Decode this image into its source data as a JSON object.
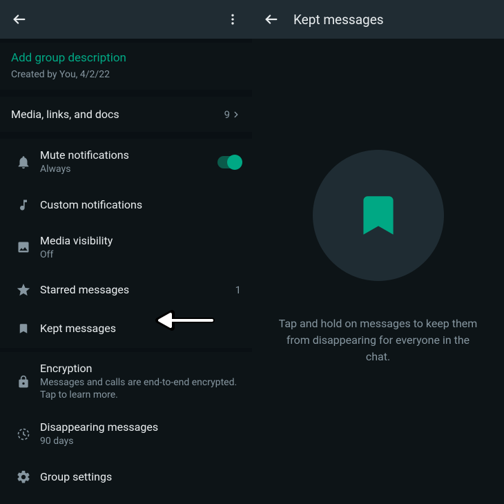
{
  "left": {
    "addDesc": "Add group description",
    "created": "Created by You, 4/2/22",
    "media": {
      "label": "Media, links, and docs",
      "count": "9"
    },
    "rows": {
      "mute": {
        "title": "Mute notifications",
        "sub": "Always"
      },
      "custom": {
        "title": "Custom notifications"
      },
      "mediaV": {
        "title": "Media visibility",
        "sub": "Off"
      },
      "starred": {
        "title": "Starred messages",
        "count": "1"
      },
      "kept": {
        "title": "Kept messages"
      },
      "enc": {
        "title": "Encryption",
        "sub": "Messages and calls are end-to-end encrypted. Tap to learn more."
      },
      "disap": {
        "title": "Disappearing messages",
        "sub": "90 days"
      },
      "group": {
        "title": "Group settings"
      }
    }
  },
  "right": {
    "title": "Kept messages",
    "emptyMsg": "Tap and hold on messages to keep them from disappearing for everyone in the chat."
  }
}
